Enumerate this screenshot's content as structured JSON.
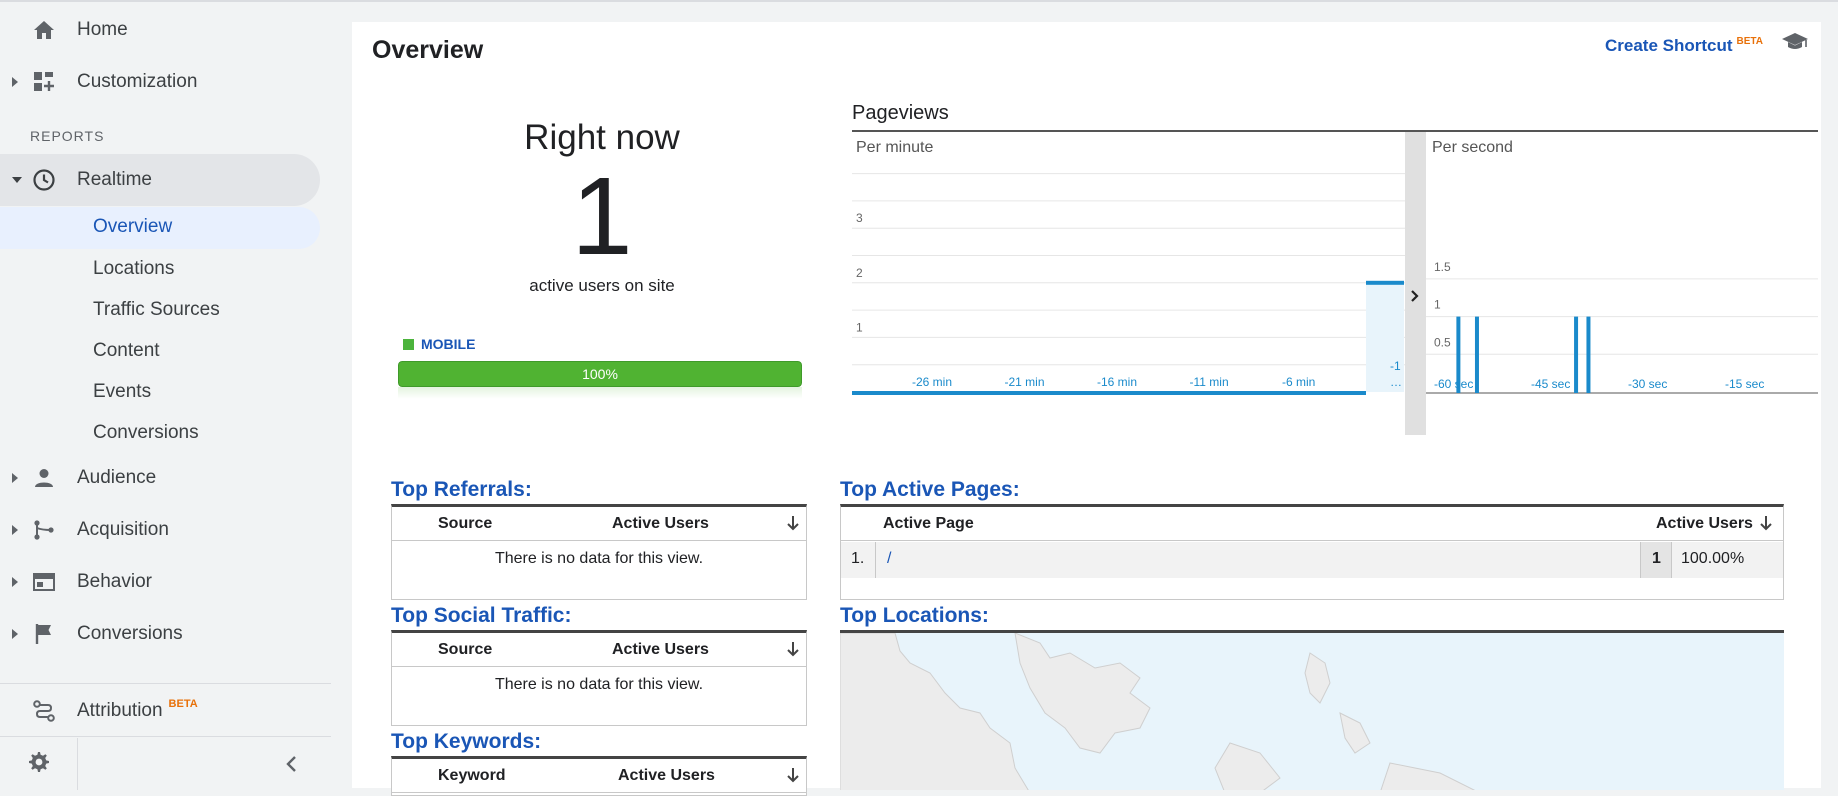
{
  "sidebar": {
    "home": "Home",
    "customization": "Customization",
    "reports_label": "REPORTS",
    "realtime": "Realtime",
    "realtime_items": [
      "Overview",
      "Locations",
      "Traffic Sources",
      "Content",
      "Events",
      "Conversions"
    ],
    "audience": "Audience",
    "acquisition": "Acquisition",
    "behavior": "Behavior",
    "conversions": "Conversions",
    "attribution": "Attribution",
    "attribution_badge": "BETA"
  },
  "header": {
    "title": "Overview",
    "shortcut": "Create Shortcut",
    "shortcut_badge": "BETA"
  },
  "realtime_summary": {
    "heading": "Right now",
    "count": "1",
    "caption": "active users on site",
    "device_label": "MOBILE",
    "device_percent_label": "100%",
    "device_fraction": 1.0,
    "device_color": "#50b332"
  },
  "pageviews": {
    "title": "Pageviews",
    "per_minute_label": "Per minute",
    "per_second_label": "Per second"
  },
  "chart_data": [
    {
      "type": "bar",
      "title": "Per minute",
      "y_ticks": [
        "1",
        "2",
        "3"
      ],
      "ylim": [
        0,
        4
      ],
      "x_ticks": [
        "-26 min",
        "-21 min",
        "-16 min",
        "-11 min",
        "-6 min",
        "-1 …"
      ],
      "x": [
        -1
      ],
      "values": [
        2
      ],
      "color": "#1a8acb"
    },
    {
      "type": "bar",
      "title": "Per second",
      "y_ticks": [
        "0.5",
        "1",
        "1.5"
      ],
      "ylim": [
        0,
        2
      ],
      "x_ticks": [
        "-60 sec",
        "-45 sec",
        "-30 sec",
        "-15 sec"
      ],
      "x": [
        -58,
        -55,
        -39,
        -37
      ],
      "values": [
        1,
        1,
        1,
        1
      ],
      "color": "#1a8acb"
    }
  ],
  "tables": {
    "referrals": {
      "title": "Top Referrals:",
      "col1": "Source",
      "col2": "Active Users",
      "empty": "There is no data for this view."
    },
    "social": {
      "title": "Top Social Traffic:",
      "col1": "Source",
      "col2": "Active Users",
      "empty": "There is no data for this view."
    },
    "keywords": {
      "title": "Top Keywords:",
      "col1": "Keyword",
      "col2": "Active Users"
    },
    "pages": {
      "title": "Top Active Pages:",
      "col1": "Active Page",
      "col2": "Active Users",
      "rows": [
        {
          "index": "1.",
          "page": "/",
          "users": "1",
          "percent": "100.00%"
        }
      ]
    },
    "locations": {
      "title": "Top Locations:"
    }
  },
  "colors": {
    "accent": "#1a56b6",
    "chart_blue": "#1a8acb",
    "mobile_green": "#50b332",
    "beta_orange": "#e8710a"
  },
  "icons": [
    "home-icon",
    "dashboard-icon",
    "clock-icon",
    "person-icon",
    "fork-icon",
    "browser-window-icon",
    "flag-icon",
    "attribution-icon",
    "gear-icon",
    "chevron-left-icon",
    "graduation-cap-icon",
    "sort-down-icon",
    "chevron-right-icon"
  ]
}
